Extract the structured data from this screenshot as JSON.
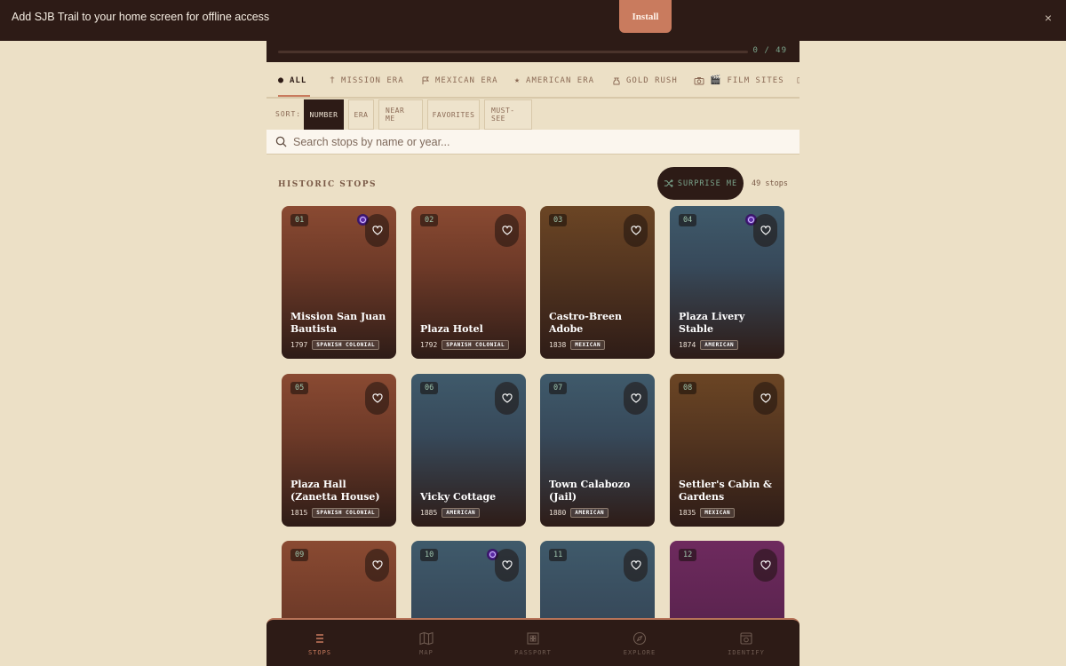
{
  "banner": {
    "text": "Add SJB Trail to your home screen for offline access",
    "install_label": "Install",
    "close_label": "×"
  },
  "progress": {
    "visited": 0,
    "total": 49,
    "text": "0 / 49"
  },
  "era_tabs": [
    {
      "label": "ALL",
      "icon": "dot-icon"
    },
    {
      "label": "MISSION ERA",
      "icon": "cross-icon"
    },
    {
      "label": "MEXICAN ERA",
      "icon": "flag-icon"
    },
    {
      "label": "AMERICAN ERA",
      "icon": "star-icon"
    },
    {
      "label": "GOLD RUSH",
      "icon": "gold-bag-icon"
    },
    {
      "label": "FILM SITES",
      "icon": "camera-icon"
    }
  ],
  "sort": {
    "label": "SORT:",
    "options": [
      "NUMBER",
      "ERA",
      "NEAR ME",
      "FAVORITES",
      "MUST-SEE"
    ],
    "selected": "NUMBER"
  },
  "search": {
    "placeholder": "Search stops by name or year...",
    "value": ""
  },
  "section": {
    "title": "HISTORIC STOPS",
    "surprise_label": "SURPRISE ME",
    "count_text": "49 stops"
  },
  "stops": [
    {
      "num": "01",
      "name": "Mission San Juan Bautista",
      "year": "1797",
      "era": "SPANISH COLONIAL",
      "visited_marker": true
    },
    {
      "num": "02",
      "name": "Plaza Hotel",
      "year": "1792",
      "era": "SPANISH COLONIAL",
      "visited_marker": false
    },
    {
      "num": "03",
      "name": "Castro-Breen Adobe",
      "year": "1838",
      "era": "MEXICAN",
      "visited_marker": false
    },
    {
      "num": "04",
      "name": "Plaza Livery Stable",
      "year": "1874",
      "era": "AMERICAN",
      "visited_marker": true
    },
    {
      "num": "05",
      "name": "Plaza Hall (Zanetta House)",
      "year": "1815",
      "era": "SPANISH COLONIAL",
      "visited_marker": false
    },
    {
      "num": "06",
      "name": "Vicky Cottage",
      "year": "1885",
      "era": "AMERICAN",
      "visited_marker": false
    },
    {
      "num": "07",
      "name": "Town Calabozo (Jail)",
      "year": "1880",
      "era": "AMERICAN",
      "visited_marker": false
    },
    {
      "num": "08",
      "name": "Settler's Cabin & Gardens",
      "year": "1835",
      "era": "MEXICAN",
      "visited_marker": false
    },
    {
      "num": "09",
      "name": "",
      "year": "",
      "era": "",
      "visited_marker": false
    },
    {
      "num": "10",
      "name": "",
      "year": "",
      "era": "",
      "visited_marker": true
    },
    {
      "num": "11",
      "name": "",
      "year": "",
      "era": "",
      "visited_marker": false
    },
    {
      "num": "12",
      "name": "",
      "year": "",
      "era": "",
      "visited_marker": false
    }
  ],
  "colors": {
    "spanish_colonial": "#8a4a32",
    "mexican": "#6b4524",
    "american": "#3f5a6b",
    "gold_rush": "#6e2a5e",
    "card_bottom": "#2e1c17",
    "accent": "#c97b5e",
    "nav_bg": "#2d1b16"
  },
  "bottom_nav": [
    {
      "label": "STOPS",
      "icon": "list-icon",
      "active": true
    },
    {
      "label": "MAP",
      "icon": "map-icon",
      "active": false
    },
    {
      "label": "PASSPORT",
      "icon": "passport-icon",
      "active": false
    },
    {
      "label": "EXPLORE",
      "icon": "compass-icon",
      "active": false
    },
    {
      "label": "IDENTIFY",
      "icon": "camera-frame-icon",
      "active": false
    }
  ]
}
